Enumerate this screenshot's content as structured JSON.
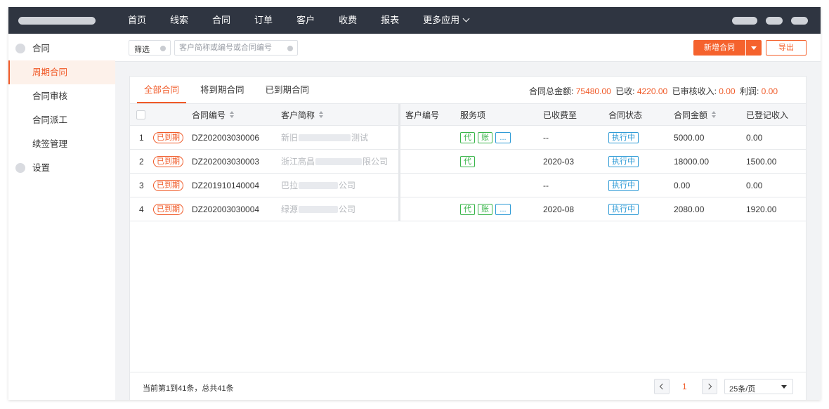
{
  "topbar": {
    "nav": [
      {
        "label": "首页"
      },
      {
        "label": "线索"
      },
      {
        "label": "合同"
      },
      {
        "label": "订单"
      },
      {
        "label": "客户"
      },
      {
        "label": "收费"
      },
      {
        "label": "报表"
      },
      {
        "label": "更多应用",
        "icon": "chevron-down-icon"
      }
    ]
  },
  "sidebar": {
    "items": [
      {
        "label": "合同",
        "type": "group"
      },
      {
        "label": "周期合同",
        "type": "sub",
        "active": true
      },
      {
        "label": "合同审核",
        "type": "sub"
      },
      {
        "label": "合同派工",
        "type": "sub"
      },
      {
        "label": "续签管理",
        "type": "sub"
      },
      {
        "label": "设置",
        "type": "group"
      }
    ]
  },
  "toolbar": {
    "filter_label": "筛选",
    "search_placeholder": "客户简称或编号或合同编号",
    "new_button": "新增合同",
    "export_button": "导出"
  },
  "tabs": [
    {
      "label": "全部合同",
      "active": true
    },
    {
      "label": "将到期合同"
    },
    {
      "label": "已到期合同"
    }
  ],
  "summary": {
    "total_label": "合同总金额:",
    "total_value": "75480.00",
    "received_label": "已收:",
    "received_value": "4220.00",
    "audited_label": "已审核收入:",
    "audited_value": "0.00",
    "profit_label": "利润:",
    "profit_value": "0.00"
  },
  "table": {
    "headers": {
      "contract_no": "合同编号",
      "customer_name": "客户简称",
      "customer_no": "客户编号",
      "services": "服务项",
      "paid_until": "已收费至",
      "status": "合同状态",
      "amount": "合同金额",
      "income": "已登记收入"
    },
    "rows": [
      {
        "index": "1",
        "tag": "已到期",
        "contract_no": "DZ202003030006",
        "customer_a": "新旧",
        "customer_b": "测试",
        "services": [
          "代",
          "账",
          "..."
        ],
        "paid_until": "--",
        "status": "执行中",
        "amount": "5000.00",
        "income": "0.00"
      },
      {
        "index": "2",
        "tag": "已到期",
        "contract_no": "DZ202003030003",
        "customer_a": "浙江高昌",
        "customer_b": "限公司",
        "services": [
          "代"
        ],
        "paid_until": "2020-03",
        "status": "执行中",
        "amount": "18000.00",
        "income": "1500.00"
      },
      {
        "index": "3",
        "tag": "已到期",
        "contract_no": "DZ201910140004",
        "customer_a": "巴拉",
        "customer_b": "公司",
        "services": [],
        "paid_until": "--",
        "status": "执行中",
        "amount": "0.00",
        "income": "0.00"
      },
      {
        "index": "4",
        "tag": "已到期",
        "contract_no": "DZ202003030004",
        "customer_a": "绿源",
        "customer_b": "公司",
        "services": [
          "代",
          "账",
          "..."
        ],
        "paid_until": "2020-08",
        "status": "执行中",
        "amount": "2080.00",
        "income": "1920.00"
      }
    ]
  },
  "pagination": {
    "info": "当前第1到41条，总共41条",
    "current_page": "1",
    "page_size": "25条/页"
  },
  "colors": {
    "topbar": "#2f3541",
    "accent": "#f05a28",
    "service_tag": "#39b54a",
    "status_tag": "#2f9bd6"
  }
}
